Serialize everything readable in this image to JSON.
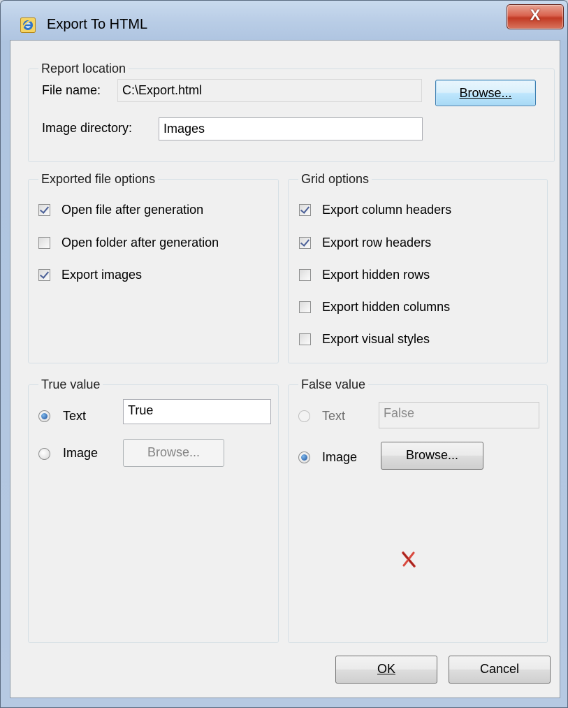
{
  "window": {
    "title": "Export To HTML",
    "close_label": "X",
    "accent_color": "#c23a24"
  },
  "report_location": {
    "title": "Report location",
    "file_name_label": "File name:",
    "file_name_value": "C:\\Export.html",
    "browse_label": "Browse...",
    "image_dir_label": "Image directory:",
    "image_dir_value": "Images"
  },
  "exported_file_options": {
    "title": "Exported file options",
    "items": [
      {
        "label": "Open file after generation",
        "checked": true
      },
      {
        "label": "Open folder after generation",
        "checked": false
      },
      {
        "label": "Export images",
        "checked": true
      }
    ]
  },
  "grid_options": {
    "title": "Grid options",
    "items": [
      {
        "label": "Export column headers",
        "checked": true
      },
      {
        "label": "Export row headers",
        "checked": true
      },
      {
        "label": "Export hidden rows",
        "checked": false
      },
      {
        "label": "Export hidden columns",
        "checked": false
      },
      {
        "label": "Export visual styles",
        "checked": false
      }
    ]
  },
  "true_value": {
    "title": "True value",
    "text_label": "Text",
    "text_selected": true,
    "text_value": "True",
    "image_label": "Image",
    "image_selected": false,
    "browse_label": "Browse..."
  },
  "false_value": {
    "title": "False value",
    "text_label": "Text",
    "text_selected": false,
    "text_value": "False",
    "image_label": "Image",
    "image_selected": true,
    "browse_label": "Browse...",
    "preview_icon": "red-x-icon"
  },
  "footer": {
    "ok_label": "OK",
    "cancel_label": "Cancel"
  }
}
